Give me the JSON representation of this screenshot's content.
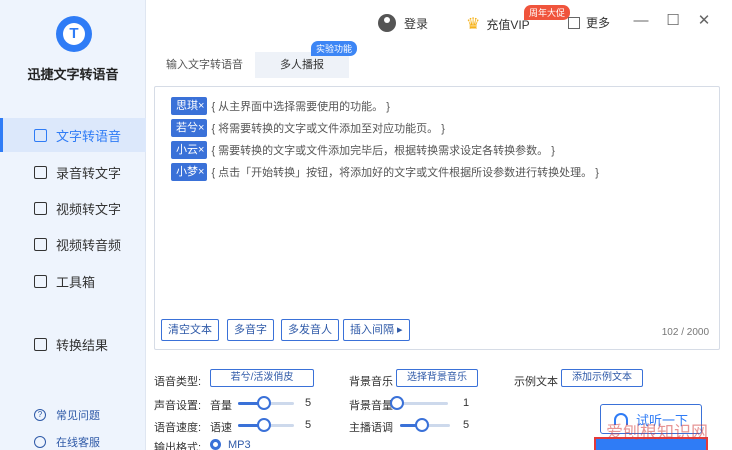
{
  "app": {
    "name": "迅捷文字转语音",
    "logo_glyph": "T"
  },
  "sidebar": {
    "items": [
      {
        "label": "文字转语音",
        "icon": "text-to-speech-icon",
        "active": true
      },
      {
        "label": "录音转文字",
        "icon": "recording-icon"
      },
      {
        "label": "视频转文字",
        "icon": "video-text-icon"
      },
      {
        "label": "视频转音频",
        "icon": "video-audio-icon"
      },
      {
        "label": "工具箱",
        "icon": "toolbox-icon"
      },
      {
        "label": "转换结果",
        "icon": "result-icon"
      }
    ],
    "faq": "常见问题",
    "support": "在线客服"
  },
  "topbar": {
    "login": "登录",
    "vip": "充值VIP",
    "vip_badge": "周年大促",
    "more": "更多",
    "minimize": "—",
    "maximize": "☐",
    "close": "✕"
  },
  "tabs": {
    "items": [
      "输入文字转语音",
      "多人播报"
    ],
    "badge": "实验功能"
  },
  "editor": {
    "lines": [
      {
        "tag": "思琪×",
        "text": "{ 从主界面中选择需要使用的功能。 }"
      },
      {
        "tag": "若兮×",
        "text": "{ 将需要转换的文字或文件添加至对应功能页。 }"
      },
      {
        "tag": "小云×",
        "text": "{ 需要转换的文字或文件添加完毕后，根据转换需求设定各转换参数。 }"
      },
      {
        "tag": "小梦×",
        "text": "{ 点击「开始转换」按钮，将添加好的文字或文件根据所设参数进行转换处理。 }"
      }
    ],
    "buttons": [
      "清空文本",
      "多音字",
      "多发音人",
      "插入间隔 ▸"
    ],
    "counter": "102 / 2000"
  },
  "settings": {
    "voice_type_label": "语音类型:",
    "voice_type_value": "若兮/活泼俏皮",
    "bg_music_label": "背景音乐",
    "bg_music_btn": "选择背景音乐",
    "sample_label": "示例文本",
    "sample_btn": "添加示例文本",
    "volume_label": "声音设置:",
    "volume_sub": "音量",
    "volume_value": "5",
    "speed_label": "语音速度:",
    "speed_sub": "语速",
    "speed_value": "5",
    "bg_volume_label": "背景音量",
    "bg_volume_value": "1",
    "pitch_label": "主播语调",
    "pitch_value": "5",
    "format_label": "输出格式:",
    "format_value": "MP3",
    "trial_btn": "试听一下",
    "watermark": "爱刨根知识网"
  },
  "colors": {
    "accent": "#2f7cf6",
    "tag": "#3a71d8",
    "badge_red": "#f0543c",
    "sidebar_bg": "#eef4fd"
  }
}
